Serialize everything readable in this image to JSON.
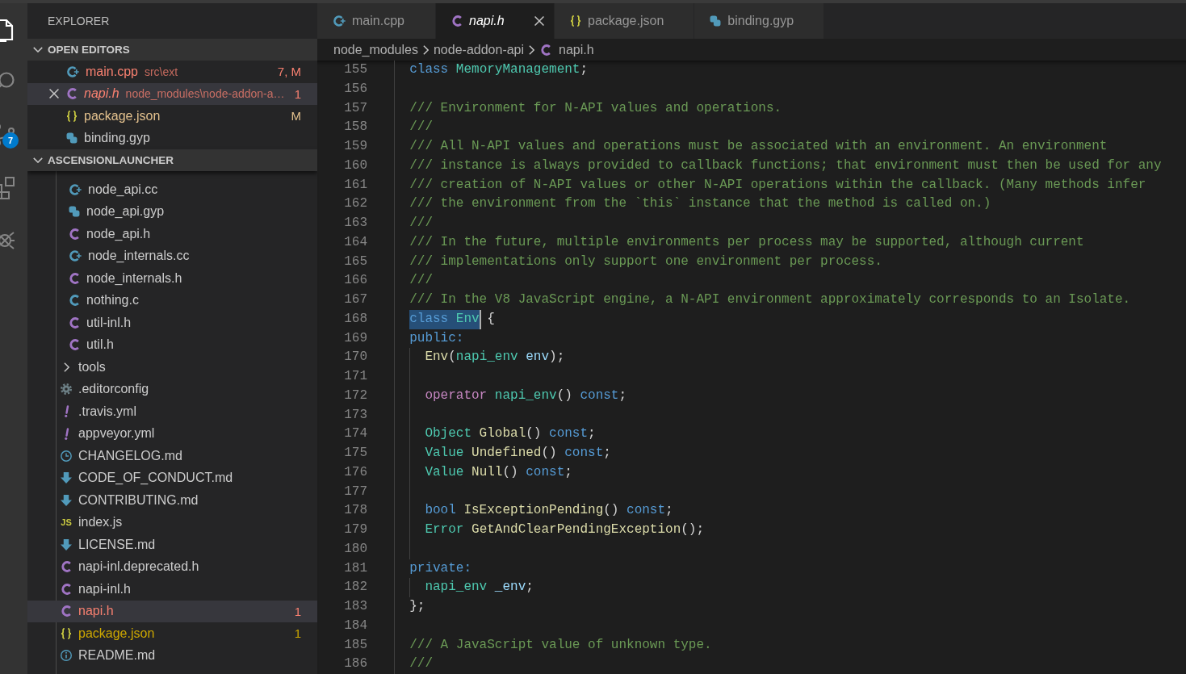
{
  "activity_bar": {
    "items": [
      {
        "kind": "files",
        "selected": true
      },
      {
        "kind": "search",
        "selected": false
      },
      {
        "kind": "source_control",
        "selected": false,
        "badge": "7"
      },
      {
        "kind": "extensions",
        "selected": false
      },
      {
        "kind": "debug",
        "selected": false
      }
    ]
  },
  "explorer": {
    "title": "EXPLORER",
    "sections": [
      {
        "title": "OPEN EDITORS",
        "kind": "open_editors",
        "expanded": true,
        "items": [
          {
            "label": "main.cpp",
            "kind": "cpp",
            "description": "src\\ext",
            "badge": "7, M",
            "color": "#f88070",
            "selected": false,
            "preview": false
          },
          {
            "label": "napi.h",
            "kind": "h",
            "description": "node_modules\\node-addon-a…",
            "badge": "1",
            "color": "#f88070",
            "selected": true,
            "preview": true
          },
          {
            "label": "package.json",
            "kind": "json",
            "badge": "M",
            "color": "#e2c08d",
            "selected": false,
            "preview": false
          },
          {
            "label": "binding.gyp",
            "kind": "gyp",
            "selected": false,
            "preview": false
          }
        ]
      },
      {
        "title": "ASCENSIONLAUNCHER",
        "kind": "tree",
        "expanded": true,
        "items": [
          {
            "children": [
              {
                "label": "node_api.cc",
                "kind": "cpp",
                "selected": false
              },
              {
                "label": "node_api.gyp",
                "kind": "gyp",
                "selected": false
              },
              {
                "label": "node_api.h",
                "kind": "h",
                "selected": false
              },
              {
                "label": "node_internals.cc",
                "kind": "cpp",
                "selected": false
              },
              {
                "label": "node_internals.h",
                "kind": "h",
                "selected": false
              },
              {
                "label": "nothing.c",
                "kind": "c",
                "selected": false
              },
              {
                "label": "util-inl.h",
                "kind": "h",
                "selected": false
              },
              {
                "label": "util.h",
                "kind": "h",
                "selected": false
              }
            ]
          },
          {
            "label": "tools",
            "kind": "folder",
            "expanded": false,
            "selected": false
          },
          {
            "label": ".editorconfig",
            "kind": "config",
            "selected": false
          },
          {
            "label": ".travis.yml",
            "kind": "yaml",
            "selected": false
          },
          {
            "label": "appveyor.yml",
            "kind": "yaml",
            "selected": false
          },
          {
            "label": "CHANGELOG.md",
            "kind": "changelog",
            "selected": false
          },
          {
            "label": "CODE_OF_CONDUCT.md",
            "kind": "markdown",
            "selected": false
          },
          {
            "label": "CONTRIBUTING.md",
            "kind": "markdown",
            "selected": false
          },
          {
            "label": "index.js",
            "kind": "js",
            "icon_text": "JS",
            "selected": false
          },
          {
            "label": "LICENSE.md",
            "kind": "markdown",
            "selected": false
          },
          {
            "label": "napi-inl.deprecated.h",
            "kind": "h",
            "selected": false
          },
          {
            "label": "napi-inl.h",
            "kind": "h",
            "selected": false
          },
          {
            "label": "napi.h",
            "kind": "h",
            "badge": "1",
            "color": "#f88070",
            "selected": true
          },
          {
            "label": "package.json",
            "kind": "json",
            "badge": "1",
            "color": "#cca700",
            "selected": false
          },
          {
            "label": "README.md",
            "kind": "readme",
            "selected": false
          }
        ]
      }
    ]
  },
  "tabs": [
    {
      "label": "main.cpp",
      "kind": "cpp",
      "selected": false,
      "preview": false
    },
    {
      "label": "napi.h",
      "kind": "h",
      "selected": true,
      "preview": true
    },
    {
      "label": "package.json",
      "kind": "json",
      "selected": false,
      "preview": false
    },
    {
      "label": "binding.gyp",
      "kind": "gyp",
      "selected": false,
      "preview": false
    }
  ],
  "breadcrumb": [
    {
      "label": "node_modules",
      "kind": "folder"
    },
    {
      "label": "node-addon-api",
      "kind": "folder"
    },
    {
      "label": "napi.h",
      "kind": "h"
    }
  ],
  "editor": {
    "lines": [
      {
        "number": "155",
        "tokens": [
          {
            "text": "class",
            "kind": "keyword"
          },
          {
            "text": " MemoryManagement",
            "kind": "type"
          },
          {
            "text": ";",
            "kind": "plain"
          }
        ]
      },
      {
        "number": "156"
      },
      {
        "number": "157",
        "tokens": [
          {
            "text": "/// Environment for N-API values and operations.",
            "kind": "comment"
          }
        ]
      },
      {
        "number": "158",
        "tokens": [
          {
            "text": "///",
            "kind": "comment"
          }
        ]
      },
      {
        "number": "159",
        "tokens": [
          {
            "text": "/// All N-API values and operations must be associated with an environment. An environment",
            "kind": "comment"
          }
        ]
      },
      {
        "number": "160",
        "tokens": [
          {
            "text": "/// instance is always provided to callback functions; that environment must then be used for any",
            "kind": "comment"
          }
        ]
      },
      {
        "number": "161",
        "tokens": [
          {
            "text": "/// creation of N-API values or other N-API operations within the callback. (Many methods infer",
            "kind": "comment"
          }
        ]
      },
      {
        "number": "162",
        "tokens": [
          {
            "text": "/// the environment from the `this` instance that the method is called on.)",
            "kind": "comment"
          }
        ]
      },
      {
        "number": "163",
        "tokens": [
          {
            "text": "///",
            "kind": "comment"
          }
        ]
      },
      {
        "number": "164",
        "tokens": [
          {
            "text": "/// In the future, multiple environments per process may be supported, although current",
            "kind": "comment"
          }
        ]
      },
      {
        "number": "165",
        "tokens": [
          {
            "text": "/// implementations only support one environment per process.",
            "kind": "comment"
          }
        ]
      },
      {
        "number": "166",
        "tokens": [
          {
            "text": "///",
            "kind": "comment"
          }
        ]
      },
      {
        "number": "167",
        "tokens": [
          {
            "text": "/// In the V8 JavaScript engine, a N-API environment approximately corresponds to an Isolate.",
            "kind": "comment"
          }
        ]
      },
      {
        "number": "168",
        "tokens": [
          {
            "kind": "selection",
            "cursor": true,
            "tokens": [
              {
                "text": "class",
                "kind": "keyword"
              },
              {
                "text": " Env",
                "kind": "type"
              }
            ]
          },
          {
            "text": " {",
            "kind": "plain"
          }
        ]
      },
      {
        "number": "169",
        "tokens": [
          {
            "text": "public:",
            "kind": "keyword"
          }
        ],
        "children": [
          {
            "number": "170",
            "tokens": [
              {
                "text": "Env",
                "kind": "function"
              },
              {
                "text": "(",
                "kind": "plain"
              },
              {
                "text": "napi_env",
                "kind": "type"
              },
              {
                "text": " env",
                "kind": "variable"
              },
              {
                "text": ");",
                "kind": "plain"
              }
            ]
          },
          {
            "number": "171"
          },
          {
            "number": "172",
            "tokens": [
              {
                "text": "operator",
                "kind": "control"
              },
              {
                "text": " napi_env",
                "kind": "type"
              },
              {
                "text": "() ",
                "kind": "plain"
              },
              {
                "text": "const",
                "kind": "keyword"
              },
              {
                "text": ";",
                "kind": "plain"
              }
            ]
          },
          {
            "number": "173"
          },
          {
            "number": "174",
            "tokens": [
              {
                "text": "Object",
                "kind": "type"
              },
              {
                "text": " Global",
                "kind": "function"
              },
              {
                "text": "() ",
                "kind": "plain"
              },
              {
                "text": "const",
                "kind": "keyword"
              },
              {
                "text": ";",
                "kind": "plain"
              }
            ]
          },
          {
            "number": "175",
            "tokens": [
              {
                "text": "Value",
                "kind": "type"
              },
              {
                "text": " Undefined",
                "kind": "function"
              },
              {
                "text": "() ",
                "kind": "plain"
              },
              {
                "text": "const",
                "kind": "keyword"
              },
              {
                "text": ";",
                "kind": "plain"
              }
            ]
          },
          {
            "number": "176",
            "tokens": [
              {
                "text": "Value",
                "kind": "type"
              },
              {
                "text": " Null",
                "kind": "function"
              },
              {
                "text": "() ",
                "kind": "plain"
              },
              {
                "text": "const",
                "kind": "keyword"
              },
              {
                "text": ";",
                "kind": "plain"
              }
            ]
          },
          {
            "number": "177"
          },
          {
            "number": "178",
            "tokens": [
              {
                "text": "bool",
                "kind": "keyword"
              },
              {
                "text": " IsExceptionPending",
                "kind": "function"
              },
              {
                "text": "() ",
                "kind": "plain"
              },
              {
                "text": "const",
                "kind": "keyword"
              },
              {
                "text": ";",
                "kind": "plain"
              }
            ]
          },
          {
            "number": "179",
            "tokens": [
              {
                "text": "Error",
                "kind": "type"
              },
              {
                "text": " GetAndClearPendingException",
                "kind": "function"
              },
              {
                "text": "();",
                "kind": "plain"
              }
            ]
          },
          {
            "number": "180"
          }
        ]
      },
      {
        "number": "181",
        "tokens": [
          {
            "text": "private:",
            "kind": "keyword"
          }
        ],
        "children": [
          {
            "number": "182",
            "tokens": [
              {
                "text": "napi_env",
                "kind": "type"
              },
              {
                "text": " _env",
                "kind": "variable"
              },
              {
                "text": ";",
                "kind": "plain"
              }
            ]
          }
        ]
      },
      {
        "number": "183",
        "tokens": [
          {
            "text": "};",
            "kind": "plain"
          }
        ]
      },
      {
        "number": "184"
      },
      {
        "number": "185",
        "tokens": [
          {
            "text": "/// A JavaScript value of unknown type.",
            "kind": "comment"
          }
        ]
      },
      {
        "number": "186",
        "tokens": [
          {
            "text": "///",
            "kind": "comment"
          }
        ]
      }
    ]
  }
}
